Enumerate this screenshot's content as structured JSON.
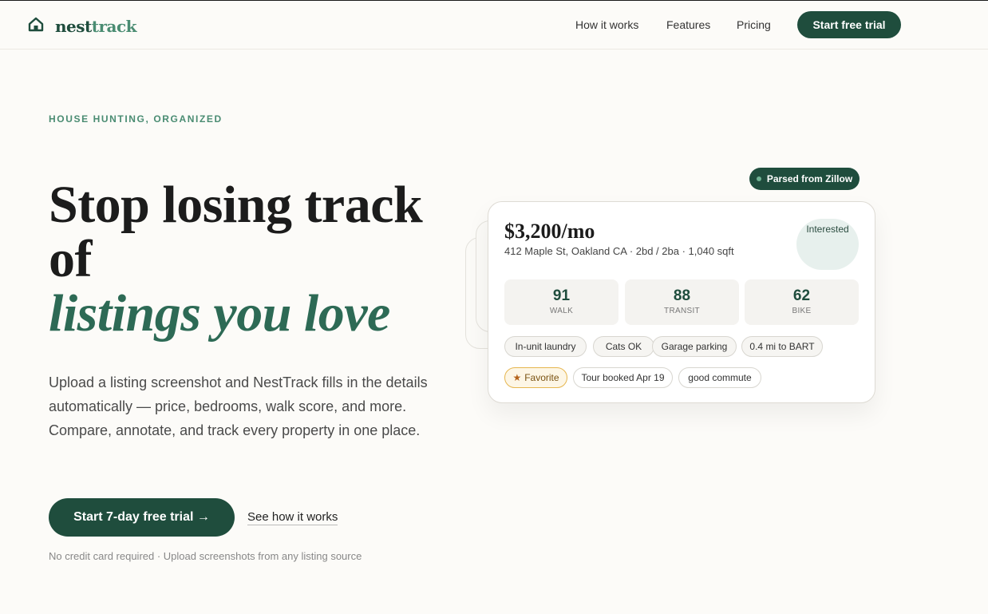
{
  "nav": {
    "brand_a": "nest",
    "brand_b": "track",
    "links": [
      "How it works",
      "Features",
      "Pricing"
    ],
    "cta": "Start free trial",
    "logo_icon": "house-icon"
  },
  "hero": {
    "eyebrow": "HOUSE HUNTING, ORGANIZED",
    "headline_line1": "Stop losing track of",
    "headline_accent": "listings you love",
    "lede": "Upload a listing screenshot and NestTrack fills in the details automatically — price, bedrooms, walk score, and more. Compare, annotate, and track every property in one place.",
    "cta": "Start 7-day free trial →",
    "secondary": "See how it works",
    "fineprint": "No credit card required · Upload screenshots from any listing source"
  },
  "listing": {
    "parsed_badge": "Parsed from Zillow",
    "price": "$3,200/mo",
    "address": "412 Maple St, Oakland CA · 2bd / 2ba · 1,040 sqft",
    "status": "Interested",
    "scores": [
      {
        "value": "91",
        "label": "WALK"
      },
      {
        "value": "88",
        "label": "TRANSIT"
      },
      {
        "value": "62",
        "label": "BIKE"
      }
    ],
    "features": [
      "In-unit laundry",
      "Cats OK",
      "Garage parking",
      "0.4 mi to BART"
    ],
    "tags": [
      "Favorite",
      "Tour booked Apr 19",
      "good commute"
    ]
  },
  "colors": {
    "brand_dark": "#1f4d3d",
    "brand_accent": "#4a8c72",
    "background": "#fcfbf8"
  }
}
